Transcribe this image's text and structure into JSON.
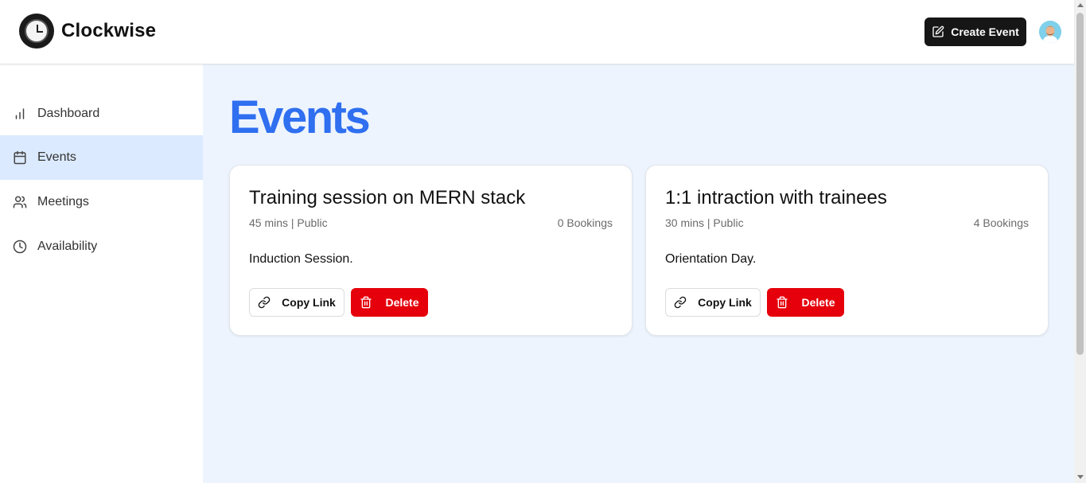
{
  "app": {
    "name": "Clockwise",
    "logo_icon": "clock-logo-icon"
  },
  "header": {
    "create_event_label": "Create Event",
    "create_event_icon": "edit-square-icon",
    "avatar_icon": "user-avatar"
  },
  "sidebar": {
    "items": [
      {
        "label": "Dashboard",
        "icon": "bar-chart-icon",
        "active": false
      },
      {
        "label": "Events",
        "icon": "calendar-icon",
        "active": true
      },
      {
        "label": "Meetings",
        "icon": "users-icon",
        "active": false
      },
      {
        "label": "Availability",
        "icon": "clock-icon",
        "active": false
      }
    ]
  },
  "main": {
    "title": "Events",
    "events": [
      {
        "title": "Training session on MERN stack",
        "meta": "45 mins | Public",
        "bookings": "0 Bookings",
        "description": "Induction Session.",
        "copy_label": "Copy Link",
        "delete_label": "Delete"
      },
      {
        "title": "1:1 intraction with trainees",
        "meta": "30 mins | Public",
        "bookings": "4 Bookings",
        "description": "Orientation Day.",
        "copy_label": "Copy Link",
        "delete_label": "Delete"
      }
    ]
  },
  "colors": {
    "accent": "#2f6ff0",
    "delete": "#e5000b",
    "active_nav": "#dbeafe",
    "main_bg": "#eef4fe",
    "create_button": "#161616"
  }
}
